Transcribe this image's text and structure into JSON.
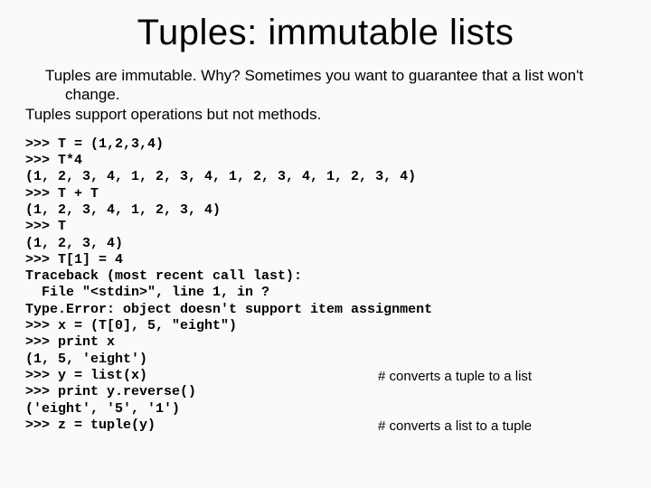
{
  "title": "Tuples: immutable lists",
  "intro": {
    "p1": "Tuples are immutable. Why? Sometimes you want to guarantee that a list won't change.",
    "p2": "Tuples support operations but not methods."
  },
  "code": ">>> T = (1,2,3,4)\n>>> T*4\n(1, 2, 3, 4, 1, 2, 3, 4, 1, 2, 3, 4, 1, 2, 3, 4)\n>>> T + T\n(1, 2, 3, 4, 1, 2, 3, 4)\n>>> T\n(1, 2, 3, 4)\n>>> T[1] = 4\nTraceback (most recent call last):\n  File \"<stdin>\", line 1, in ?\nType.Error: object doesn't support item assignment\n>>> x = (T[0], 5, \"eight\")\n>>> print x\n(1, 5, 'eight')\n>>> y = list(x)\n>>> print y.reverse()\n('eight', '5', '1')\n>>> z = tuple(y)",
  "comments": {
    "c1": "# converts a tuple to a list",
    "c2": "# converts a list to a tuple"
  }
}
